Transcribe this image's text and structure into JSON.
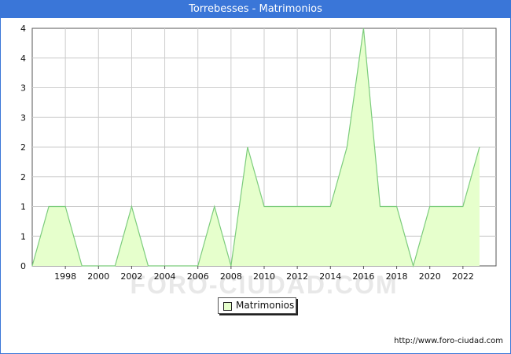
{
  "header": {
    "title": "Torrebesses - Matrimonios"
  },
  "watermark": "FORO-CIUDAD.COM",
  "source_url": "http://www.foro-ciudad.com",
  "colors": {
    "title_bar": "#3a76d8",
    "area_fill": "#e6ffcc",
    "line": "#7ccc7c",
    "grid": "#cccccc"
  },
  "chart_data": {
    "type": "area",
    "title": "Torrebesses - Matrimonios",
    "x": [
      1996,
      1997,
      1998,
      1999,
      2000,
      2001,
      2002,
      2003,
      2004,
      2005,
      2006,
      2007,
      2008,
      2009,
      2010,
      2011,
      2012,
      2013,
      2014,
      2015,
      2016,
      2017,
      2018,
      2019,
      2020,
      2021,
      2022,
      2023
    ],
    "series": [
      {
        "name": "Matrimonios",
        "values": [
          0,
          1,
          1,
          0,
          0,
          0,
          1,
          0,
          0,
          0,
          0,
          1,
          0,
          2,
          1,
          1,
          1,
          1,
          1,
          2,
          4,
          1,
          1,
          0,
          1,
          1,
          1,
          2
        ]
      }
    ],
    "x_ticks": [
      "1998",
      "2000",
      "2002",
      "2004",
      "2006",
      "2008",
      "2010",
      "2012",
      "2014",
      "2016",
      "2018",
      "2020",
      "2022"
    ],
    "y_tick_labels": [
      "0",
      "1",
      "1",
      "2",
      "2",
      "3",
      "3",
      "4",
      "4"
    ],
    "xlim": [
      1996,
      2024
    ],
    "ylim": [
      0,
      4
    ],
    "grid": true,
    "legend": {
      "position": "bottom-center",
      "entries": [
        "Matrimonios"
      ]
    }
  }
}
